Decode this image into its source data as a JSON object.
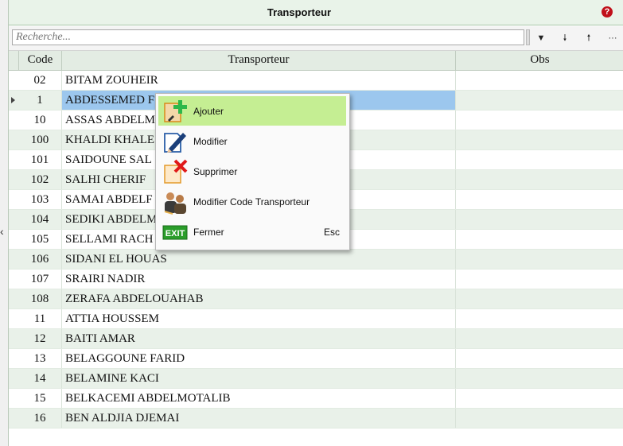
{
  "window": {
    "title": "Transporteur",
    "help_icon": "?"
  },
  "toolbar": {
    "search_placeholder": "Recherche...",
    "buttons": [
      {
        "icon": "filter-icon",
        "glyph": "▼"
      },
      {
        "icon": "arrow-down-icon",
        "glyph": "🠗"
      },
      {
        "icon": "arrow-up-icon",
        "glyph": "🠕"
      },
      {
        "icon": "more-icon",
        "glyph": "···"
      }
    ]
  },
  "grid": {
    "columns": [
      "Code",
      "Transporteur",
      "Obs"
    ],
    "selected_code": "1",
    "rows": [
      {
        "code": "02",
        "name": "BITAM ZOUHEIR"
      },
      {
        "code": "1",
        "name": "ABDESSEMED F"
      },
      {
        "code": "10",
        "name": "ASSAS ABDELM"
      },
      {
        "code": "100",
        "name": "KHALDI KHALE"
      },
      {
        "code": "101",
        "name": "SAIDOUNE SAL"
      },
      {
        "code": "102",
        "name": "SALHI CHERIF"
      },
      {
        "code": "103",
        "name": "SAMAI ABDELF"
      },
      {
        "code": "104",
        "name": "SEDIKI ABDELM"
      },
      {
        "code": "105",
        "name": "SELLAMI RACH"
      },
      {
        "code": "106",
        "name": "SIDANI EL HOUAS"
      },
      {
        "code": "107",
        "name": "SRAIRI NADIR"
      },
      {
        "code": "108",
        "name": "ZERAFA ABDELOUAHAB"
      },
      {
        "code": "11",
        "name": "ATTIA HOUSSEM"
      },
      {
        "code": "12",
        "name": "BAITI AMAR"
      },
      {
        "code": "13",
        "name": "BELAGGOUNE FARID"
      },
      {
        "code": "14",
        "name": "BELAMINE KACI"
      },
      {
        "code": "15",
        "name": "BELKACEMI ABDELMOTALIB"
      },
      {
        "code": "16",
        "name": "BEN ALDJIA DJEMAI"
      }
    ]
  },
  "context_menu": {
    "items": [
      {
        "label": "Ajouter",
        "icon": "add-icon",
        "shortcut": "",
        "highlighted": true
      },
      {
        "label": "Modifier",
        "icon": "edit-icon",
        "shortcut": "",
        "highlighted": false
      },
      {
        "label": "Supprimer",
        "icon": "delete-icon",
        "shortcut": "",
        "highlighted": false
      },
      {
        "label": "Modifier Code Transporteur",
        "icon": "users-icon",
        "shortcut": "",
        "highlighted": false
      },
      {
        "label": "Fermer",
        "icon": "exit-icon",
        "shortcut": "Esc",
        "highlighted": false
      }
    ],
    "exit_icon_text": "EXIT"
  },
  "colors": {
    "header_bg": "#e9f3e9",
    "row_alt": "#e9f1e9",
    "selection": "#9cc7ee",
    "menu_highlight": "#c5ee93",
    "help_red": "#c0101a"
  }
}
